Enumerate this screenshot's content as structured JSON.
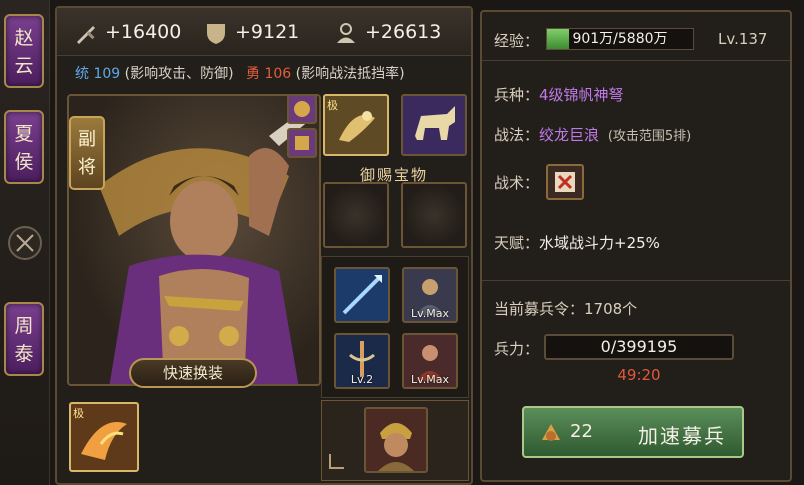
{
  "sidebar": {
    "tabs": [
      {
        "label_1": "赵",
        "label_2": "云"
      },
      {
        "label_1": "夏",
        "label_2": "侯"
      },
      {
        "label_1": "周",
        "label_2": "泰"
      }
    ],
    "middle_icon": "crossed-swords-icon"
  },
  "stats": {
    "attack": "+16400",
    "defense": "+9121",
    "leadership": "+26613"
  },
  "attributes": {
    "tong_label": "统",
    "tong_value": "109",
    "tong_desc": "(影响攻击、防御)",
    "yong_label": "勇",
    "yong_value": "106",
    "yong_desc": "(影响战法抵挡率)"
  },
  "hero": {
    "deputy_label_1": "副",
    "deputy_label_2": "将",
    "quick_equip": "快速换装"
  },
  "slots": {
    "extreme_mark": "极",
    "royal_label": "御赐宝物",
    "lv_max": "Lv.Max",
    "lv_2": "Lv.2"
  },
  "info": {
    "xp_label": "经验：",
    "xp_value": "901万/5880万",
    "xp_fraction": 0.153,
    "level": "Lv.137",
    "troop_type_label": "兵种：",
    "troop_type_value": "4级锦帆神弩",
    "tactic_label": "战法：",
    "tactic_value": "绞龙巨浪",
    "tactic_desc": "(攻击范围5排)",
    "art_label": "战术：",
    "talent_label": "天赋：",
    "talent_value": "水域战斗力+25%",
    "recruit_orders": "当前募兵令：1708个",
    "troops_label": "兵力：",
    "troops_value": "0/399195",
    "timer": "49:20",
    "recruit_count": "22",
    "recruit_button": "加速募兵"
  },
  "colors": {
    "panel_border": "#5b4a33",
    "tab_purple": "#7a3f8e",
    "xp_green": "#7fd06a",
    "timer_red": "#e05a3a",
    "stat_blue": "#5fa8e8",
    "stat_red": "#e25c3c",
    "troop_purple": "#c07ae8",
    "recruit_green": "#5b8e5a"
  }
}
